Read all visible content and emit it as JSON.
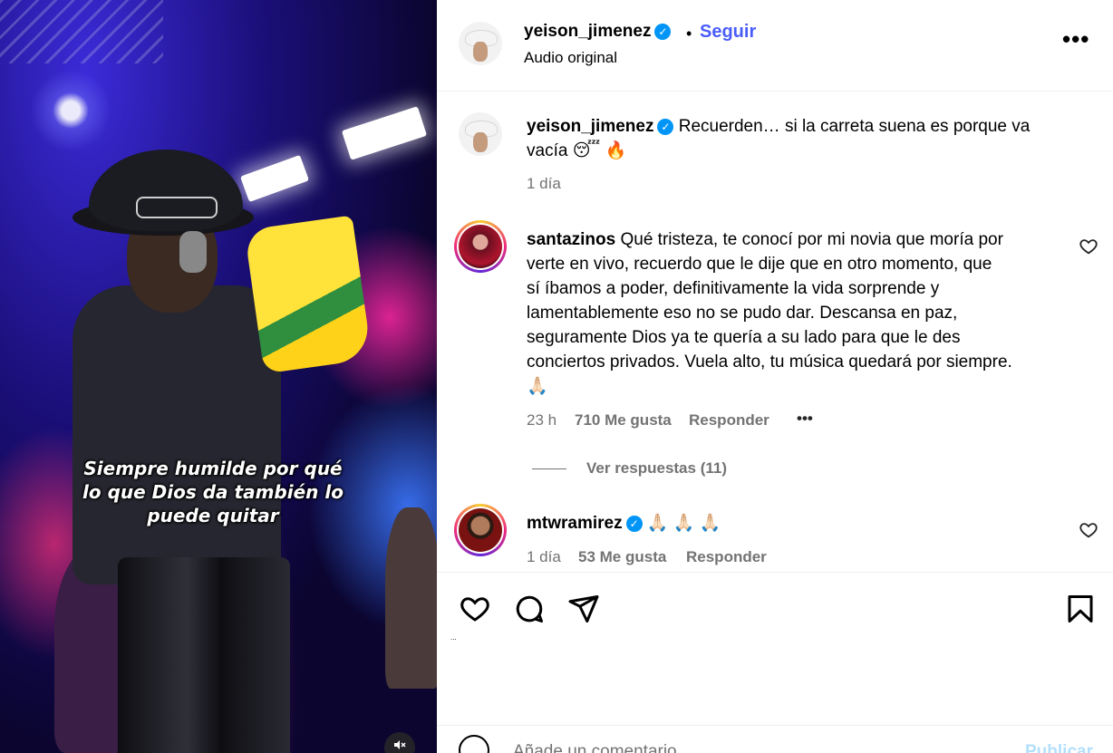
{
  "video": {
    "caption_lines": [
      "Siempre humilde por qué",
      "lo que Dios da también lo",
      "puede quitar"
    ],
    "mute_icon": "speaker-muted-icon"
  },
  "header": {
    "username": "yeison_jimenez",
    "dot": "•",
    "follow_label": "Seguir",
    "audio_label": "Audio original",
    "more_label": "•••"
  },
  "post": {
    "username": "yeison_jimenez",
    "caption_line1": "Recuerden… si la carreta suena es porque va",
    "caption_line2": "vacía 😴 🔥",
    "time": "1 día"
  },
  "comments": [
    {
      "username": "santazinos",
      "lines": [
        "Qué tristeza, te conocí por mi novia que moría por",
        "verte en vivo, recuerdo que le dije que en otro momento, que",
        "sí íbamos a poder, definitivamente la vida sorprende y",
        "lamentablemente eso no se pudo dar. Descansa en paz,",
        "seguramente Dios ya te quería a su lado para que le des",
        "conciertos privados. Vuela alto, tu música quedará por siempre.",
        "🙏🏻"
      ],
      "time": "23 h",
      "likes": "710 Me gusta",
      "reply": "Responder",
      "options": "•••",
      "view_replies": "Ver respuestas (11)"
    },
    {
      "username": "mtwramirez",
      "text": "🙏🏻 🙏🏻 🙏🏻",
      "time": "1 día",
      "likes": "53 Me gusta",
      "reply": "Responder"
    }
  ],
  "actions": {
    "tiny_text": "..."
  },
  "add_comment": {
    "placeholder": "Añade un comentario...",
    "publish_label": "Publicar"
  }
}
